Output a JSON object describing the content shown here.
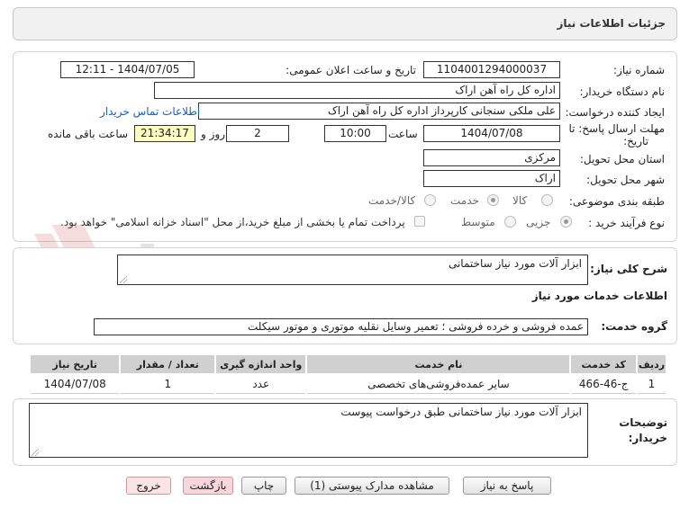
{
  "header": {
    "title": "جزئیات اطلاعات نیاز"
  },
  "form": {
    "need_number_label": "شماره نیاز:",
    "need_number": "1104001294000037",
    "announce_label": "تاریخ و ساعت اعلان عمومی:",
    "announce_value": "1404/07/05 - 12:11",
    "buyer_org_label": "نام دستگاه خریدار:",
    "buyer_org": "اداره کل راه آهن اراک",
    "creator_label": "ایجاد کننده درخواست:",
    "creator": "علی ملکی سنجانی کارپرداز اداره کل راه آهن اراک",
    "contact_link": "اطلاعات تماس خریدار",
    "deadline_label_1": "مهلت ارسال پاسخ: تا",
    "deadline_label_2": "تاریخ:",
    "deadline_date": "1404/07/08",
    "time_label": "ساعت",
    "deadline_time": "10:00",
    "days_value": "2",
    "days_label": "روز و",
    "remaining_time": "21:34:17",
    "remaining_label": "ساعت باقی مانده",
    "province_label": "استان محل تحویل:",
    "province": "مرکزی",
    "city_label": "شهر محل تحویل:",
    "city": "اراک",
    "category_label": "طبقه بندی موضوعی:",
    "category_options": [
      "کالا",
      "خدمت",
      "کالا/خدمت"
    ],
    "category_selected": "خدمت",
    "process_label": "نوع فرآیند خرید :",
    "process_options": [
      "جزیی",
      "متوسط"
    ],
    "payment_note": "پرداخت تمام یا بخشی از مبلغ خرید،از محل \"اسناد خزانه اسلامی\" خواهد بود."
  },
  "summary": {
    "label": "شرح کلی نیاز:",
    "value": "ابزار آلات مورد نیاز ساختمانی"
  },
  "services": {
    "section_title": "اطلاعات خدمات مورد نیاز",
    "group_label": "گروه خدمت:",
    "group_value": "عمده فروشی و خرده فروشی ؛ تعمیر وسایل نقلیه موتوری و موتور سیکلت",
    "columns": [
      "ردیف",
      "کد خدمت",
      "نام خدمت",
      "واحد اندازه گیری",
      "تعداد / مقدار",
      "تاریخ نیاز"
    ],
    "rows": [
      {
        "row": "1",
        "code": "ج-46-466",
        "name": "سایر عمده‌فروشی‌های تخصصی",
        "unit": "عدد",
        "qty": "1",
        "date": "1404/07/08"
      }
    ]
  },
  "buyer_notes": {
    "label_1": "توضیحات",
    "label_2": "خریدار:",
    "value": "ابزار آلات مورد نیاز ساختمانی طبق درخواست پیوست"
  },
  "buttons": {
    "reply": "پاسخ به نیاز",
    "view_docs": "مشاهده مدارک پیوستی (1)",
    "print": "چاپ",
    "back": "بازگشت",
    "exit": "خروج"
  },
  "watermark": {
    "text": "AriaTender.net"
  },
  "colors": {
    "accent_link": "#1a5fb4",
    "highlight": "#fffcc0",
    "header_bg": "#f1f1f1"
  }
}
